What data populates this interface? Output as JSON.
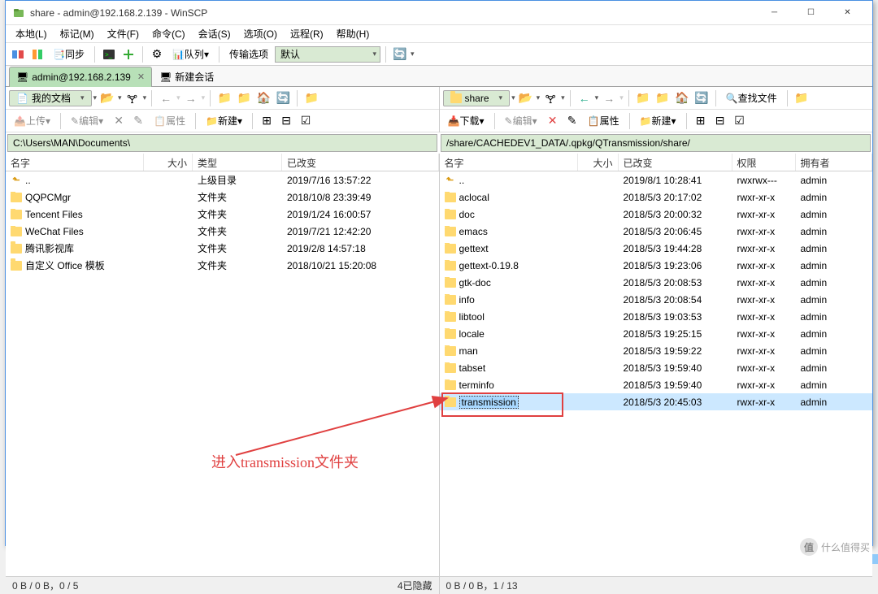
{
  "title": "share - admin@192.168.2.139 - WinSCP",
  "menu": [
    "本地(L)",
    "标记(M)",
    "文件(F)",
    "命令(C)",
    "会话(S)",
    "选项(O)",
    "远程(R)",
    "帮助(H)"
  ],
  "toolbar_main": {
    "sync": "同步",
    "queue": "队列",
    "transfer_label": "传输选项",
    "transfer_value": "默认"
  },
  "tabs": {
    "active": "admin@192.168.2.139",
    "new": "新建会话"
  },
  "left": {
    "location": "我的文档",
    "upload": "上传",
    "edit": "编辑",
    "props": "属性",
    "new": "新建",
    "path": "C:\\Users\\MAN\\Documents\\",
    "headers": {
      "name": "名字",
      "size": "大小",
      "type": "类型",
      "changed": "已改变"
    },
    "rows": [
      {
        "name": "..",
        "type": "上级目录",
        "date": "2019/7/16  13:57:22",
        "up": true
      },
      {
        "name": "QQPCMgr",
        "type": "文件夹",
        "date": "2018/10/8  23:39:49"
      },
      {
        "name": "Tencent Files",
        "type": "文件夹",
        "date": "2019/1/24  16:00:57"
      },
      {
        "name": "WeChat Files",
        "type": "文件夹",
        "date": "2019/7/21  12:42:20"
      },
      {
        "name": "腾讯影视库",
        "type": "文件夹",
        "date": "2019/2/8  14:57:18"
      },
      {
        "name": "自定义 Office 模板",
        "type": "文件夹",
        "date": "2018/10/21  15:20:08"
      }
    ],
    "status_left": "0 B / 0 B，0 / 5",
    "status_right": "4已隐藏"
  },
  "right": {
    "location": "share",
    "download": "下载",
    "edit": "编辑",
    "props": "属性",
    "new": "新建",
    "find": "查找文件",
    "path": "/share/CACHEDEV1_DATA/.qpkg/QTransmission/share/",
    "headers": {
      "name": "名字",
      "size": "大小",
      "changed": "已改变",
      "rights": "权限",
      "owner": "拥有者"
    },
    "rows": [
      {
        "name": "..",
        "date": "2019/8/1 10:28:41",
        "perm": "rwxrwx---",
        "owner": "admin",
        "up": true
      },
      {
        "name": "aclocal",
        "date": "2018/5/3 20:17:02",
        "perm": "rwxr-xr-x",
        "owner": "admin"
      },
      {
        "name": "doc",
        "date": "2018/5/3 20:00:32",
        "perm": "rwxr-xr-x",
        "owner": "admin"
      },
      {
        "name": "emacs",
        "date": "2018/5/3 20:06:45",
        "perm": "rwxr-xr-x",
        "owner": "admin"
      },
      {
        "name": "gettext",
        "date": "2018/5/3 19:44:28",
        "perm": "rwxr-xr-x",
        "owner": "admin"
      },
      {
        "name": "gettext-0.19.8",
        "date": "2018/5/3 19:23:06",
        "perm": "rwxr-xr-x",
        "owner": "admin"
      },
      {
        "name": "gtk-doc",
        "date": "2018/5/3 20:08:53",
        "perm": "rwxr-xr-x",
        "owner": "admin"
      },
      {
        "name": "info",
        "date": "2018/5/3 20:08:54",
        "perm": "rwxr-xr-x",
        "owner": "admin"
      },
      {
        "name": "libtool",
        "date": "2018/5/3 19:03:53",
        "perm": "rwxr-xr-x",
        "owner": "admin"
      },
      {
        "name": "locale",
        "date": "2018/5/3 19:25:15",
        "perm": "rwxr-xr-x",
        "owner": "admin"
      },
      {
        "name": "man",
        "date": "2018/5/3 19:59:22",
        "perm": "rwxr-xr-x",
        "owner": "admin"
      },
      {
        "name": "tabset",
        "date": "2018/5/3 19:59:40",
        "perm": "rwxr-xr-x",
        "owner": "admin"
      },
      {
        "name": "terminfo",
        "date": "2018/5/3 19:59:40",
        "perm": "rwxr-xr-x",
        "owner": "admin"
      },
      {
        "name": "transmission",
        "date": "2018/5/3 20:45:03",
        "perm": "rwxr-xr-x",
        "owner": "admin",
        "selected": true
      }
    ],
    "status_left": "0 B / 0 B，1 / 13"
  },
  "annotation": "进入transmission文件夹",
  "watermark": "什么值得买"
}
